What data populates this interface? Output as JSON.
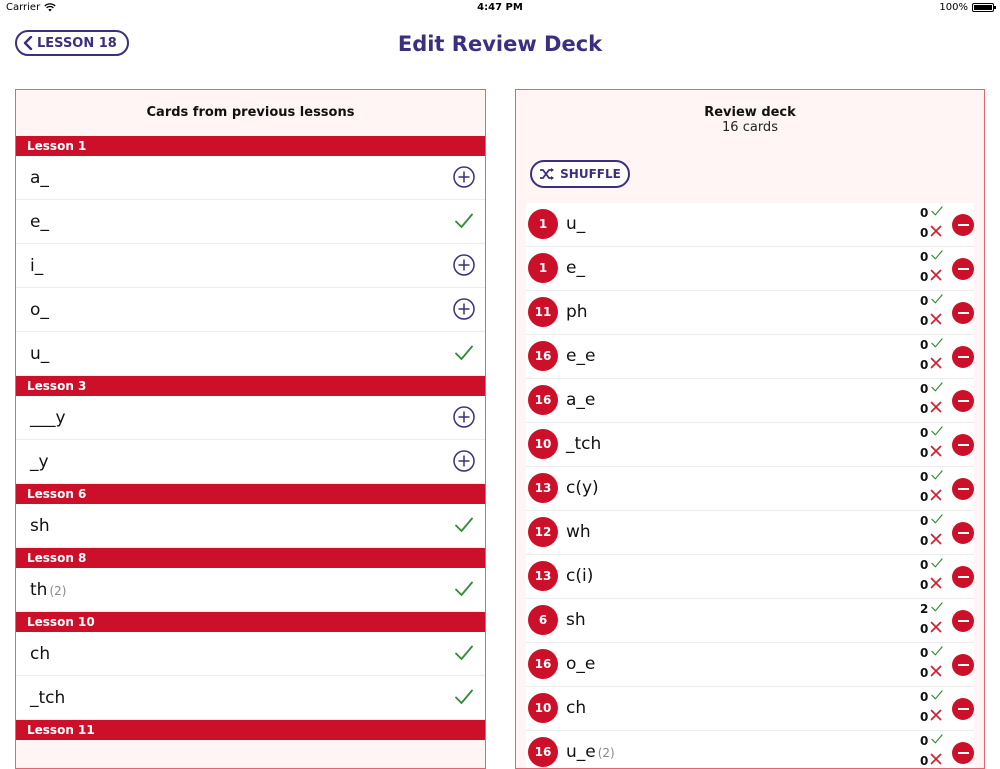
{
  "status": {
    "carrier": "Carrier",
    "time": "4:47 PM",
    "battery": "100%"
  },
  "nav": {
    "back_label": "LESSON 18",
    "title": "Edit Review Deck"
  },
  "left_panel": {
    "title": "Cards from previous lessons",
    "groups": [
      {
        "header": "Lesson 1",
        "cards": [
          {
            "label": "a_",
            "count": "",
            "state": "add"
          },
          {
            "label": "e_",
            "count": "",
            "state": "added"
          },
          {
            "label": "i_",
            "count": "",
            "state": "add"
          },
          {
            "label": "o_",
            "count": "",
            "state": "add"
          },
          {
            "label": "u_",
            "count": "",
            "state": "added"
          }
        ]
      },
      {
        "header": "Lesson 3",
        "cards": [
          {
            "label": "___y",
            "count": "",
            "state": "add"
          },
          {
            "label": "_y",
            "count": "",
            "state": "add"
          }
        ]
      },
      {
        "header": "Lesson 6",
        "cards": [
          {
            "label": "sh",
            "count": "",
            "state": "added"
          }
        ]
      },
      {
        "header": "Lesson 8",
        "cards": [
          {
            "label": "th",
            "count": "(2)",
            "state": "added"
          }
        ]
      },
      {
        "header": "Lesson 10",
        "cards": [
          {
            "label": "ch",
            "count": "",
            "state": "added"
          },
          {
            "label": "_tch",
            "count": "",
            "state": "added"
          }
        ]
      },
      {
        "header": "Lesson 11",
        "cards": []
      }
    ]
  },
  "right_panel": {
    "title": "Review deck",
    "count_text": "16 cards",
    "shuffle_label": "SHUFFLE",
    "cards": [
      {
        "lesson": "1",
        "label": "u_",
        "count": "",
        "correct": "0",
        "wrong": "0"
      },
      {
        "lesson": "1",
        "label": "e_",
        "count": "",
        "correct": "0",
        "wrong": "0"
      },
      {
        "lesson": "11",
        "label": "ph",
        "count": "",
        "correct": "0",
        "wrong": "0"
      },
      {
        "lesson": "16",
        "label": "e_e",
        "count": "",
        "correct": "0",
        "wrong": "0"
      },
      {
        "lesson": "16",
        "label": "a_e",
        "count": "",
        "correct": "0",
        "wrong": "0"
      },
      {
        "lesson": "10",
        "label": "_tch",
        "count": "",
        "correct": "0",
        "wrong": "0"
      },
      {
        "lesson": "13",
        "label": "c(y)",
        "count": "",
        "correct": "0",
        "wrong": "0"
      },
      {
        "lesson": "12",
        "label": "wh",
        "count": "",
        "correct": "0",
        "wrong": "0"
      },
      {
        "lesson": "13",
        "label": "c(i)",
        "count": "",
        "correct": "0",
        "wrong": "0"
      },
      {
        "lesson": "6",
        "label": "sh",
        "count": "",
        "correct": "2",
        "wrong": "0"
      },
      {
        "lesson": "16",
        "label": "o_e",
        "count": "",
        "correct": "0",
        "wrong": "0"
      },
      {
        "lesson": "10",
        "label": "ch",
        "count": "",
        "correct": "0",
        "wrong": "0"
      },
      {
        "lesson": "16",
        "label": "u_e",
        "count": "(2)",
        "correct": "0",
        "wrong": "0"
      }
    ]
  },
  "colors": {
    "accent": "#3b2f7f",
    "brand_red": "#cc1029",
    "check_green": "#2e8b3a",
    "panel_bg": "#fff5f5"
  },
  "icons": {
    "add": "plus-circle-icon",
    "added": "checkmark-icon",
    "remove": "minus-circle-icon",
    "shuffle": "shuffle-icon",
    "back": "chevron-left-icon"
  }
}
